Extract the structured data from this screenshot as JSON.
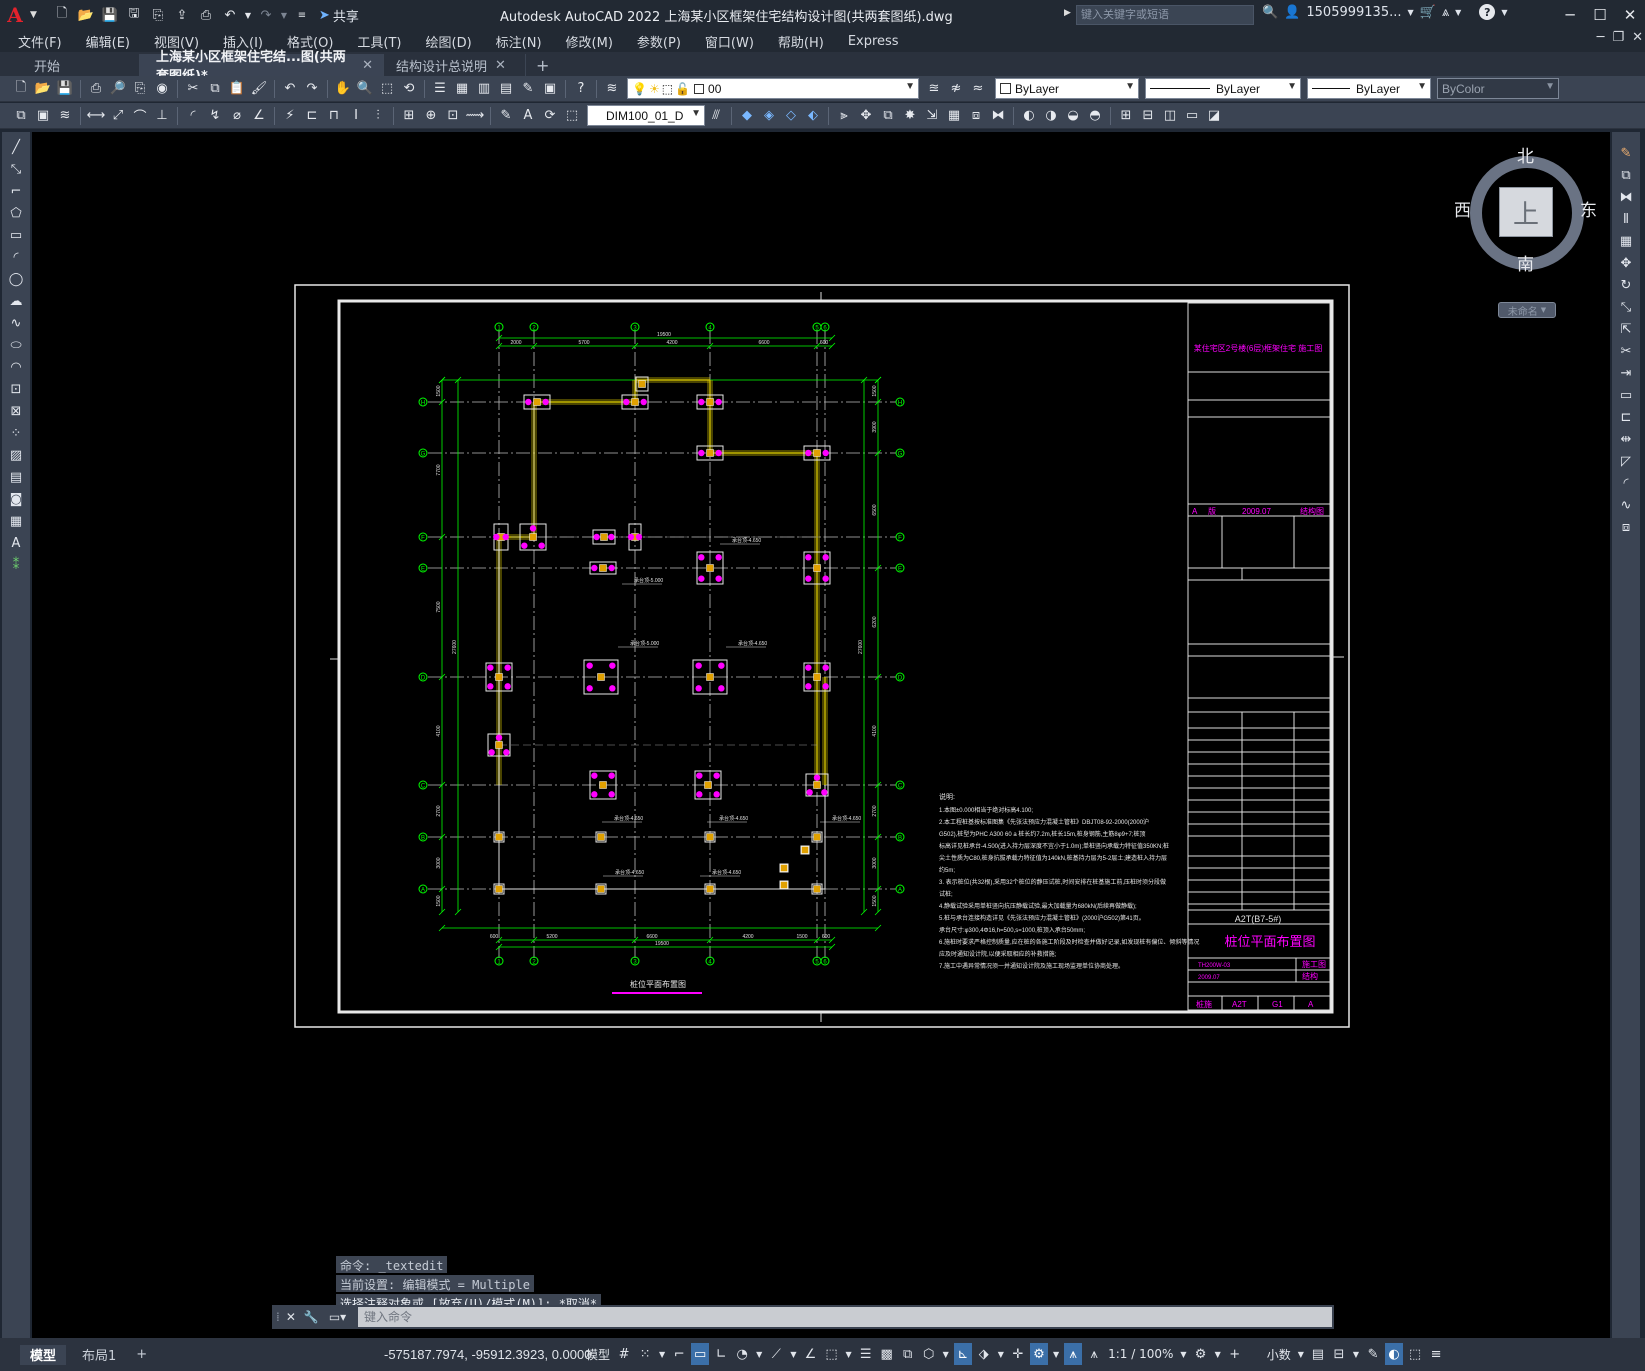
{
  "app": {
    "logo": "A",
    "title": "Autodesk AutoCAD 2022    上海某小区框架住宅结构设计图(共两套图纸).dwg",
    "share_label": "共享",
    "search_placeholder": "键入关键字或短语",
    "user": "1505999135...",
    "help": "?"
  },
  "menu": [
    "文件(F)",
    "编辑(E)",
    "视图(V)",
    "插入(I)",
    "格式(O)",
    "工具(T)",
    "绘图(D)",
    "标注(N)",
    "修改(M)",
    "参数(P)",
    "窗口(W)",
    "帮助(H)",
    "Express"
  ],
  "tabs": [
    {
      "label": "开始",
      "active": false,
      "closable": false
    },
    {
      "label": "上海某小区框架住宅结...图(共两套图纸)*",
      "active": true,
      "closable": true
    },
    {
      "label": "结构设计总说明",
      "active": false,
      "closable": true
    }
  ],
  "toolbar": {
    "layer_value": "00",
    "color_value": "ByLayer",
    "linetype_value": "ByLayer",
    "lineweight_value": "ByLayer",
    "plotstyle_value": "ByColor",
    "dimstyle_value": "DIM100_01_D"
  },
  "viewcube": {
    "north": "北",
    "south": "南",
    "east": "东",
    "west": "西",
    "top": "上",
    "wcs": "未命名"
  },
  "drawing": {
    "title_block_project": "某住宅区2号楼(6层)框架住宅 施工图",
    "revision_row": [
      "A",
      "版",
      "2009.07",
      "结构图"
    ],
    "title_block_drawing_code": "A2T(B7-5#)",
    "title_block_drawing_name": "桩位平面布置图",
    "title_block_meta": [
      [
        "TH200W-03",
        "施工图"
      ],
      [
        "2009.07",
        "结构"
      ]
    ],
    "title_block_footer": [
      "桩施",
      "A2T",
      "G1",
      "A"
    ],
    "plan_title": "桩位平面布置图",
    "grid_top": [
      "1",
      "2",
      "3",
      "4",
      "5",
      "6"
    ],
    "grid_bottom": [
      "1",
      "2",
      "3",
      "4",
      "5",
      "6"
    ],
    "grid_left": [
      "H",
      "G",
      "F",
      "E",
      "D",
      "C",
      "B",
      "A"
    ],
    "dims_top_row1": [
      "2000",
      "5700",
      "4200",
      "6600",
      "600"
    ],
    "dims_top_total": "19500",
    "dims_bottom_row1": [
      "600",
      "5200",
      "6600",
      "4200",
      "1500",
      "600"
    ],
    "dims_bottom_total": "19500",
    "dims_left": [
      "1500",
      "7700",
      "7500",
      "4100",
      "2700",
      "3000",
      "1500"
    ],
    "dims_left_total": "27600",
    "dims_right": [
      "1500",
      "3900",
      "6500",
      "6200",
      "4100",
      "2700",
      "3000",
      "1500"
    ],
    "dims_right_total": "27600",
    "pile_labels": [
      "承台顶-4.650",
      "承台顶-5.000",
      "承台顶-5.000",
      "承台顶-4.650",
      "承台顶-4.650",
      "承台顶-4.650",
      "承台顶-4.650",
      "承台顶-4.650",
      "承台顶-4.650"
    ],
    "notes_title": "说明:",
    "notes": [
      "1.本图±0.000相当于绝对标高4.100;",
      "2.本工程桩基按标准图集《先张法预应力混凝土管桩》DBJT08-92-2000(2000沪",
      "G502),桩型为PHC A300 60 a 桩长约7.2m,桩长15m,桩身钢筋,主筋8φ9+7;桩顶",
      "标高详见桩承台-4.500(进入持力层深度不宜小于1.0m);单桩竖向承载力特征值350KN;桩",
      "尖土性质为C80,桩身抗拔承载力特征值为140kN,桩基持力层为5-2层土;建造桩入持力层",
      "约5m;",
      "3.  表示桩位(共32根),采用32个桩位的静压试桩,时间安排在桩基施工前,压桩时须分段做",
      "试桩;",
      "4.静载试验采用单桩竖向抗压静载试验,最大加载量为680kN(后续再做静载);",
      "5.桩与承台连接构造详见《先张法预应力混凝土管桩》(2000沪G502)第41页。",
      "  承台尺寸:φ300,4Φ16,h=500,s=1000,桩顶入承台50mm;",
      "6.施桩时要求严格控制质量,应在桩的各施工阶段及时检查并做好记录,如发现桩有偏位、倾斜等情况",
      "应及时通知设计院,以便采取相应的补救措施;",
      "7.施工中遇异常情况须一并通知设计院及施工现场监理单位协商处理。"
    ]
  },
  "command": {
    "history": [
      "命令: _textedit",
      "当前设置: 编辑模式 = Multiple",
      "选择注释对象或 [放弃(U)/模式(M)]: *取消*"
    ],
    "placeholder": "键入命令"
  },
  "status": {
    "layout_tabs": [
      "模型",
      "布局1"
    ],
    "coords": "-575187.7974, -95912.3923, 0.0000",
    "space": "模型",
    "scale": "1:1 / 100%",
    "units": "小数"
  },
  "colors": {
    "canvas": "#000000",
    "grid": "#00ff00",
    "pile": "#ff00ff",
    "beam": "#d4c400",
    "frame": "#ffffff",
    "accent": "#3b6fa8"
  }
}
